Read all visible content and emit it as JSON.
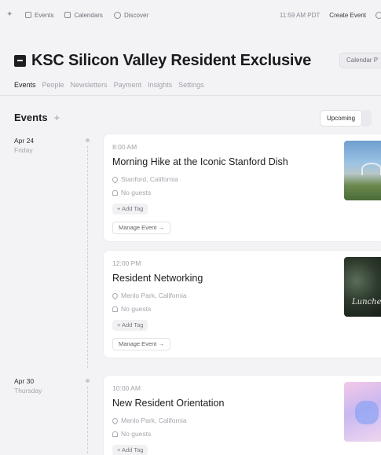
{
  "topbar": {
    "nav": [
      {
        "label": "Events",
        "icon": "ticket-icon"
      },
      {
        "label": "Calendars",
        "icon": "calendar-icon"
      },
      {
        "label": "Discover",
        "icon": "compass-icon"
      }
    ],
    "time": "11:59 AM PDT",
    "create_label": "Create Event"
  },
  "calendar": {
    "title": "KSC Silicon Valley Resident Exclusive",
    "calendar_button": "Calendar P"
  },
  "tabs": [
    {
      "label": "Events",
      "active": true
    },
    {
      "label": "People",
      "active": false
    },
    {
      "label": "Newsletters",
      "active": false
    },
    {
      "label": "Payment",
      "active": false
    },
    {
      "label": "Insights",
      "active": false
    },
    {
      "label": "Settings",
      "active": false
    }
  ],
  "events_section": {
    "heading": "Events",
    "add_symbol": "+",
    "filter_selected": "Upcoming"
  },
  "days": [
    {
      "date": "Apr 24",
      "weekday": "Friday"
    },
    {
      "date": "Apr 30",
      "weekday": "Thursday"
    }
  ],
  "events": [
    {
      "time": "8:00 AM",
      "name": "Morning Hike at the Iconic Stanford Dish",
      "location": "Stanford, California",
      "guests": "No guests",
      "add_tag": "+ Add Tag",
      "manage": "Manage Event →"
    },
    {
      "time": "12:00 PM",
      "name": "Resident Networking",
      "location": "Menlo Park, California",
      "guests": "No guests",
      "add_tag": "+ Add Tag",
      "manage": "Manage Event →"
    },
    {
      "time": "10:00 AM",
      "name": "New Resident Orientation",
      "location": "Menlo Park, California",
      "guests": "No guests",
      "add_tag": "+ Add Tag"
    }
  ]
}
